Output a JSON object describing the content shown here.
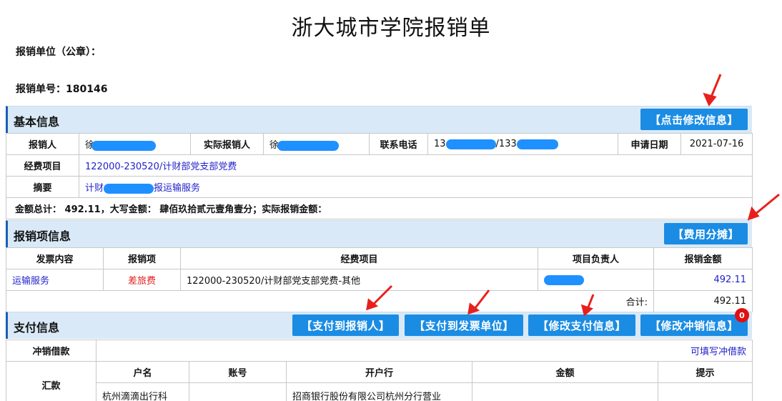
{
  "form_title": "浙大城市学院报销单",
  "meta": {
    "unit_label": "报销单位（公章）：",
    "number_label": "报销单号：",
    "number_value": "180146"
  },
  "basic": {
    "title": "基本信息",
    "edit_button": "【点击修改信息】",
    "reimburser_label": "报销人",
    "reimburser_value": "徐",
    "actual_label": "实际报销人",
    "actual_value": "徐",
    "phone_label": "联系电话",
    "phone_value_a": "13",
    "phone_value_b": "/133",
    "date_label": "申请日期",
    "date_value": "2021-07-16",
    "project_label": "经费项目",
    "project_value": "122000-230520/计财部党支部党费",
    "summary_label": "摘要",
    "summary_value_prefix": "计财",
    "summary_value_suffix": "报运输服务",
    "amount_line": "金额总计：  492.11，大写金额：  肆佰玖拾贰元壹角壹分；实际报销金额："
  },
  "items": {
    "title": "报销项信息",
    "split_button": "【费用分摊】",
    "headers": [
      "发票内容",
      "报销项",
      "经费项目",
      "项目负责人",
      "报销金额"
    ],
    "row": {
      "content": "运输服务",
      "item": "差旅费",
      "project": "122000-230520/计财部党支部党费-其他",
      "amount": "492.11"
    },
    "total_label": "合计:",
    "total_value": "492.11"
  },
  "payment": {
    "title": "支付信息",
    "buttons": {
      "pay_reimburser": "【支付到报销人】",
      "pay_invoice_unit": "【支付到发票单位】",
      "edit_payment": "【修改支付信息】",
      "edit_offset": "【修改冲销信息】"
    },
    "badge_count": "0",
    "offset_label": "冲销借款",
    "offset_hint": "可填写冲借款",
    "transfer_label": "汇款",
    "headers": [
      "户名",
      "账号",
      "开户行",
      "金额",
      "提示"
    ],
    "row": {
      "name": "杭州滴滴出行科",
      "bank": "招商银行股份有限公司杭州分行营业"
    }
  },
  "colors": {
    "accent_blue": "#1b8ce3",
    "header_bg": "#d9e9f7",
    "link": "#2222cc",
    "red": "#e02020",
    "arrow": "#e8201c"
  }
}
